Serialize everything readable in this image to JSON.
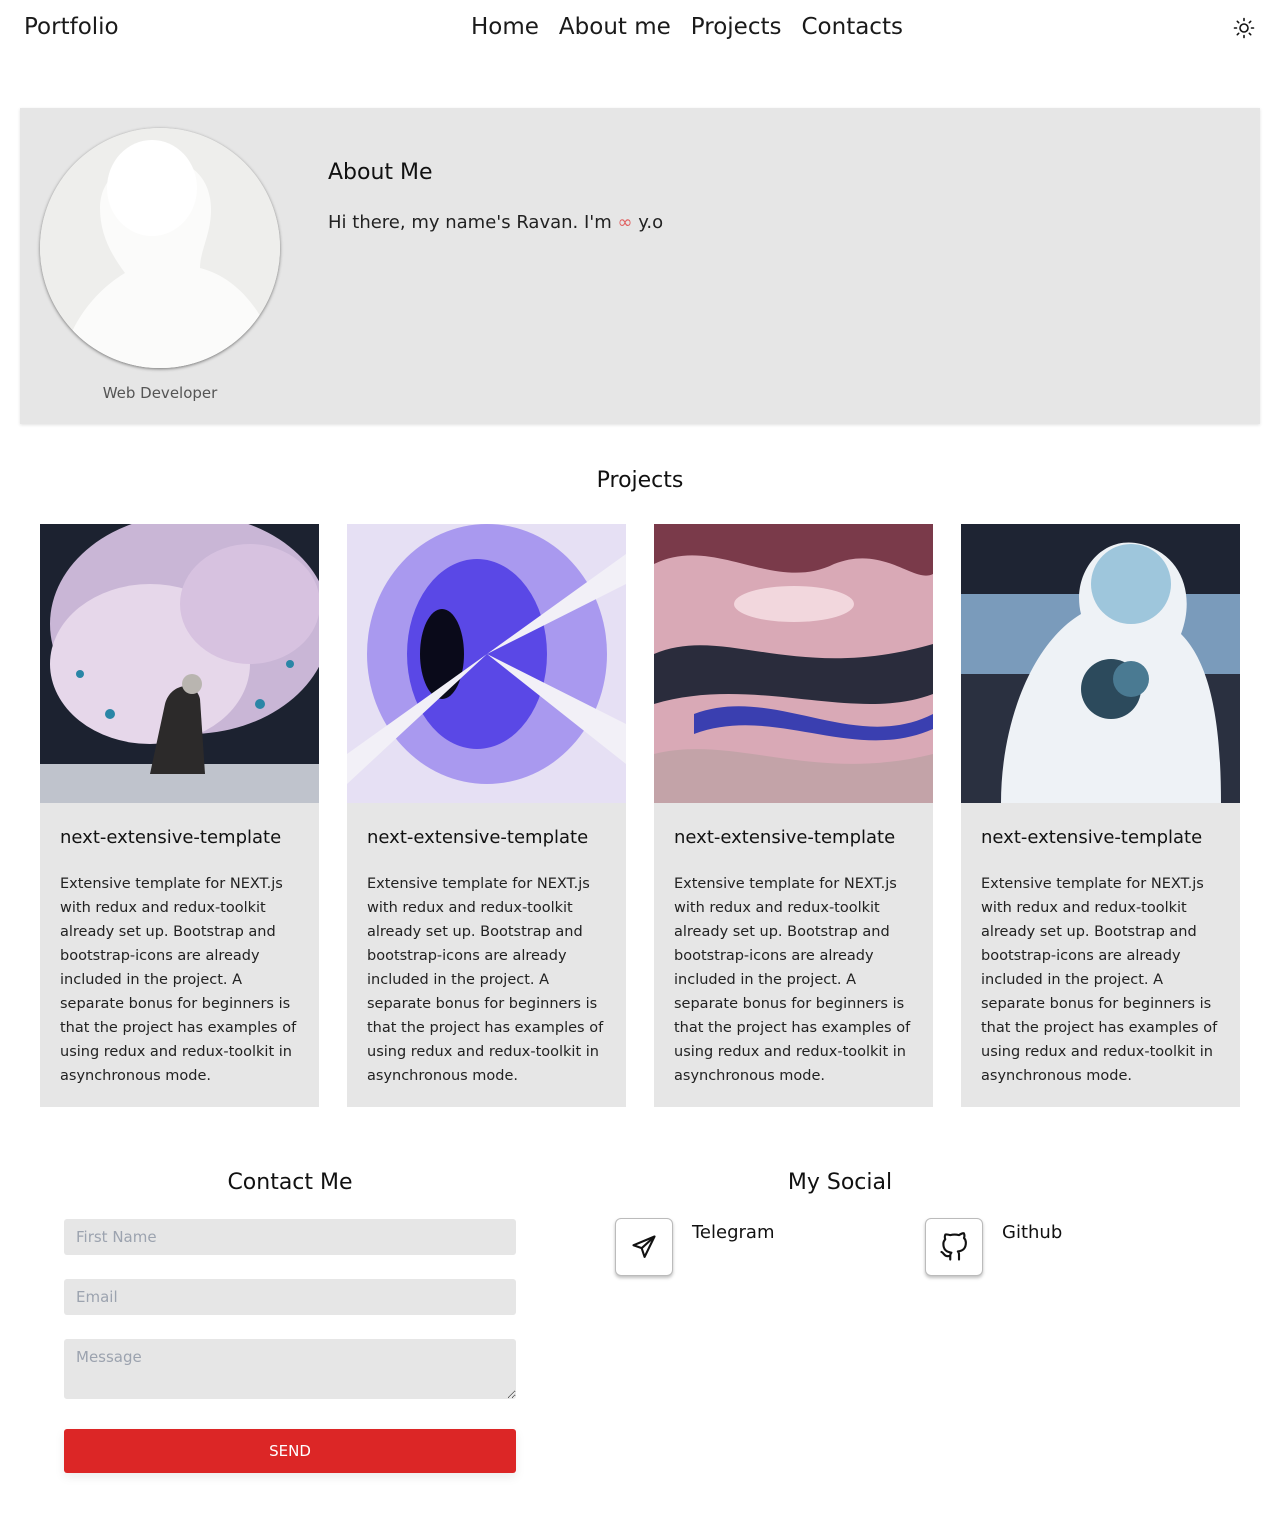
{
  "header": {
    "brand": "Portfolio",
    "nav": [
      "Home",
      "About me",
      "Projects",
      "Contacts"
    ],
    "theme_icon": "sun-icon"
  },
  "about": {
    "title": "About Me",
    "intro_before": "Hi there, my name's Ravan. I'm",
    "intro_symbol": "∞",
    "intro_after": "y.o",
    "role": "Web Developer"
  },
  "projects": {
    "title": "Projects",
    "items": [
      {
        "title": "next-extensive-template",
        "description": "Extensive template for NEXT.js with redux and redux-toolkit already set up. Bootstrap and bootstrap-icons are already included in the project. A separate bonus for beginners is that the project has examples of using redux and redux-toolkit in asynchronous mode."
      },
      {
        "title": "next-extensive-template",
        "description": "Extensive template for NEXT.js with redux and redux-toolkit already set up. Bootstrap and bootstrap-icons are already included in the project. A separate bonus for beginners is that the project has examples of using redux and redux-toolkit in asynchronous mode."
      },
      {
        "title": "next-extensive-template",
        "description": "Extensive template for NEXT.js with redux and redux-toolkit already set up. Bootstrap and bootstrap-icons are already included in the project. A separate bonus for beginners is that the project has examples of using redux and redux-toolkit in asynchronous mode."
      },
      {
        "title": "next-extensive-template",
        "description": "Extensive template for NEXT.js with redux and redux-toolkit already set up. Bootstrap and bootstrap-icons are already included in the project. A separate bonus for beginners is that the project has examples of using redux and redux-toolkit in asynchronous mode."
      }
    ]
  },
  "contact": {
    "title": "Contact Me",
    "first_name_placeholder": "First Name",
    "email_placeholder": "Email",
    "message_placeholder": "Message",
    "send_label": "SEND"
  },
  "social": {
    "title": "My Social",
    "items": [
      {
        "label": "Telegram",
        "icon": "paper-plane-icon"
      },
      {
        "label": "Github",
        "icon": "github-icon"
      }
    ]
  },
  "colors": {
    "panel_bg": "#e6e6e6",
    "accent": "#dc2626",
    "infinity": "#e06060"
  }
}
